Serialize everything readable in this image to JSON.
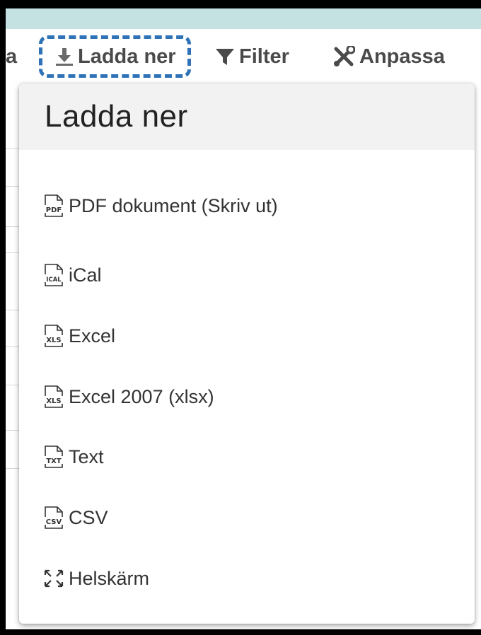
{
  "toolbar": {
    "partial_label": "a",
    "download_label": "Ladda ner",
    "filter_label": "Filter",
    "customize_label": "Anpassa"
  },
  "dropdown": {
    "title": "Ladda ner",
    "items": [
      {
        "label": "PDF dokument (Skriv ut)",
        "icon": "pdf-file-icon",
        "badge": "PDF"
      },
      {
        "label": "iCal",
        "icon": "ical-file-icon",
        "badge": "ICAL"
      },
      {
        "label": "Excel",
        "icon": "xls-file-icon",
        "badge": "XLS"
      },
      {
        "label": "Excel 2007 (xlsx)",
        "icon": "xls-file-icon",
        "badge": "XLS"
      },
      {
        "label": "Text",
        "icon": "txt-file-icon",
        "badge": "TXT"
      },
      {
        "label": "CSV",
        "icon": "csv-file-icon",
        "badge": "CSV"
      },
      {
        "label": "Helskärm",
        "icon": "fullscreen-icon"
      }
    ]
  },
  "colors": {
    "topbar": "#c5e2e3",
    "focus_outline": "#2f72b8",
    "toolbar_text": "#4a4a4a"
  }
}
